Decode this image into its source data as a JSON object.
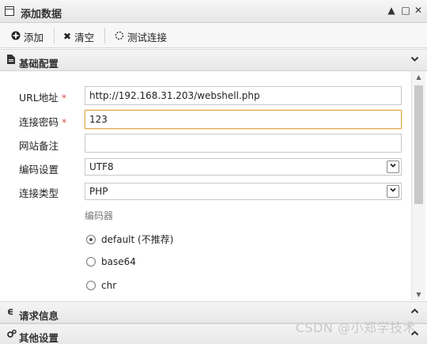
{
  "window": {
    "title": "添加数据",
    "controls": [
      "▲",
      "□",
      "✕"
    ]
  },
  "toolbar": {
    "add_label": "添加",
    "clear_label": "清空",
    "test_label": "测试连接"
  },
  "sections": {
    "basic": "基础配置",
    "request": "请求信息",
    "other": "其他设置"
  },
  "form": {
    "url_label": "URL地址",
    "url_value": "http://192.168.31.203/webshell.php",
    "password_label": "连接密码",
    "password_value": "123",
    "note_label": "网站备注",
    "note_value": "",
    "encoding_label": "编码设置",
    "encoding_value": "UTF8",
    "type_label": "连接类型",
    "type_value": "PHP",
    "required_mark": "*"
  },
  "encoder": {
    "title": "编码器",
    "options": [
      {
        "label": "default (不推荐)",
        "checked": true
      },
      {
        "label": "base64",
        "checked": false
      },
      {
        "label": "chr",
        "checked": false
      }
    ]
  },
  "watermark": "CSDN @小郑学技术",
  "icons": {
    "window": "window-icon",
    "add": "plus-circle-icon",
    "clear": "x-icon",
    "test": "spinner-icon",
    "basic": "document-icon",
    "request": "refresh-e-icon",
    "other": "gears-icon"
  }
}
